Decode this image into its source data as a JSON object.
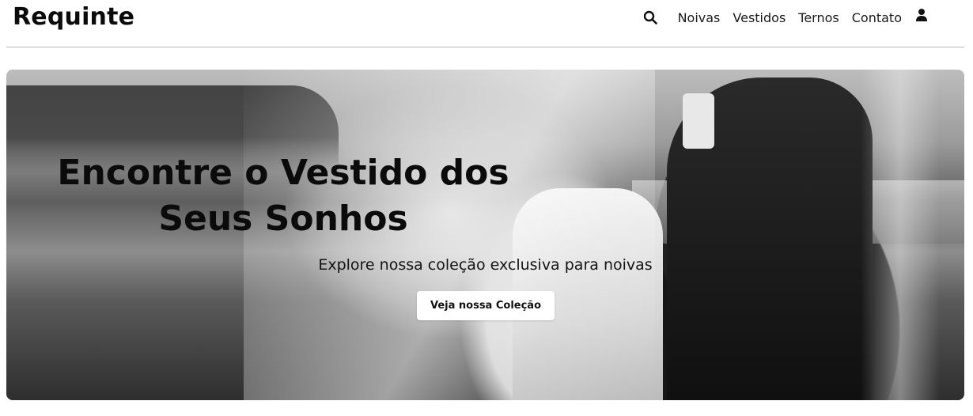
{
  "header": {
    "brand": "Requinte",
    "search_icon": "search-icon",
    "nav": [
      "Noivas",
      "Vestidos",
      "Ternos",
      "Contato"
    ],
    "user_icon": "user-icon"
  },
  "hero": {
    "title_line1": "Encontre o Vestido dos",
    "title_line2": "Seus Sonhos",
    "subtitle": "Explore nossa coleção exclusiva para noivas",
    "cta_label": "Veja nossa Coleção"
  },
  "colors": {
    "text": "#0b0b0b",
    "button_bg": "#ffffff",
    "divider": "#b9b9b9"
  }
}
